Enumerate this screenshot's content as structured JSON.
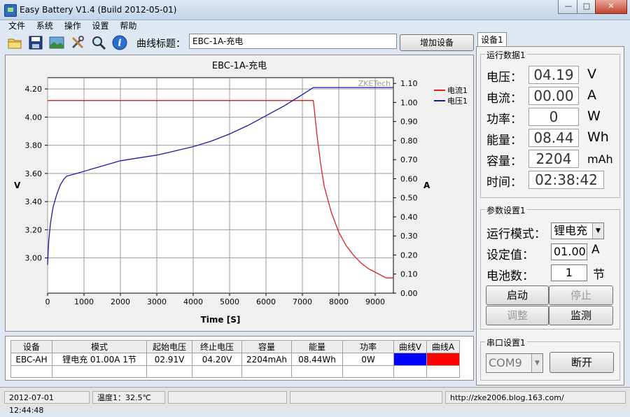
{
  "window": {
    "title": "Easy Battery V1.4 (Build 2012-05-01)",
    "minimize": "—",
    "maximize": "□",
    "close": "✕"
  },
  "menu": [
    "文件",
    "系统",
    "操作",
    "设置",
    "帮助"
  ],
  "toolbar": {
    "icons": [
      "folder-icon",
      "save-icon",
      "image-icon",
      "tools-icon",
      "magnifier-icon",
      "info-icon"
    ],
    "caption_label": "曲线标题：",
    "caption_value": "EBC-1A-充电",
    "add_device": "增加设备"
  },
  "chart_data": {
    "type": "line",
    "title": "EBC-1A-充电",
    "xlabel": "Time [S]",
    "ylabel_left": "V",
    "ylabel_right": "A",
    "watermark": "ZKETech",
    "xlim": [
      0,
      9500
    ],
    "ylim_left": [
      2.75,
      4.28
    ],
    "ylim_right": [
      0.0,
      1.13
    ],
    "x_ticks": [
      0,
      1000,
      2000,
      3000,
      4000,
      5000,
      6000,
      7000,
      8000,
      9000
    ],
    "y_ticks_left": [
      3.0,
      3.2,
      3.4,
      3.6,
      3.8,
      4.0,
      4.2
    ],
    "y_ticks_left_labels": [
      "3.00",
      "3.20",
      "3.40",
      "3.60",
      "3.80",
      "4.00",
      "4.20"
    ],
    "y_ticks_right": [
      0.0,
      0.1,
      0.2,
      0.3,
      0.4,
      0.5,
      0.6,
      0.7,
      0.8,
      0.9,
      1.0,
      1.1
    ],
    "y_ticks_right_labels": [
      "0.00",
      "0.10",
      "0.20",
      "0.30",
      "0.40",
      "0.50",
      "0.60",
      "0.70",
      "0.80",
      "0.90",
      "1.00",
      "1.10"
    ],
    "grid": true,
    "legend_position": "top-right",
    "series": [
      {
        "name": "电流1",
        "axis": "right",
        "color": "#e02020",
        "x": [
          0,
          7300,
          7350,
          7400,
          7500,
          7600,
          7800,
          8000,
          8200,
          8400,
          8600,
          8800,
          9000,
          9200,
          9300,
          9500
        ],
        "y": [
          1.01,
          1.01,
          0.92,
          0.83,
          0.68,
          0.56,
          0.42,
          0.32,
          0.25,
          0.2,
          0.16,
          0.13,
          0.11,
          0.09,
          0.08,
          0.08
        ]
      },
      {
        "name": "电压1",
        "axis": "left",
        "color": "#1a1aa8",
        "x": [
          0,
          30,
          80,
          150,
          250,
          350,
          450,
          520,
          800,
          1200,
          1600,
          2000,
          2500,
          3000,
          3500,
          4000,
          4500,
          5000,
          5500,
          6000,
          6500,
          7000,
          7300,
          7400,
          9500
        ],
        "y": [
          2.95,
          3.12,
          3.25,
          3.36,
          3.45,
          3.52,
          3.56,
          3.58,
          3.6,
          3.63,
          3.66,
          3.69,
          3.71,
          3.73,
          3.76,
          3.79,
          3.83,
          3.88,
          3.94,
          4.01,
          4.08,
          4.16,
          4.21,
          4.21,
          4.21
        ]
      }
    ]
  },
  "table": {
    "headers": [
      "设备",
      "模式",
      "起始电压",
      "终止电压",
      "容量",
      "能量",
      "功率",
      "曲线V",
      "曲线A"
    ],
    "rows": [
      [
        "EBC-AH",
        "锂电充  01.00A  1节",
        "02.91V",
        "04.20V",
        "2204mAh",
        "08.44Wh",
        "0W",
        "",
        ""
      ]
    ],
    "curve_colors": [
      "#0000ff",
      "#ff0000"
    ]
  },
  "status": {
    "datetime": "2012-07-01 12:44:48",
    "temperature": "温度1：32.5℃",
    "url": "http://zke2006.blog.163.com/"
  },
  "device": {
    "tab_label": "设备1",
    "run_group_title": "运行数据1",
    "run": [
      {
        "label": "电压：",
        "value": "04.19",
        "unit": "V"
      },
      {
        "label": "电流：",
        "value": "00.00",
        "unit": "A"
      },
      {
        "label": "功率：",
        "value": "0",
        "unit": "W"
      },
      {
        "label": "能量：",
        "value": "08.44",
        "unit": "Wh"
      },
      {
        "label": "容量：",
        "value": "2204",
        "unit": "mAh"
      },
      {
        "label": "时间：",
        "value": "02:38:42",
        "unit": ""
      }
    ],
    "param_group_title": "参数设置1",
    "mode_label": "运行模式：",
    "mode_value": "锂电充",
    "setpoint_label": "设定值：",
    "setpoint_value": "01.00",
    "setpoint_unit": "A",
    "cells_label": "电池数：",
    "cells_value": "1",
    "cells_unit": "节",
    "buttons": {
      "start": "启动",
      "stop": "停止",
      "adjust": "调整",
      "monitor": "监测"
    },
    "serial_group_title": "串口设置1",
    "port_value": "COM9",
    "disconnect": "断开"
  }
}
